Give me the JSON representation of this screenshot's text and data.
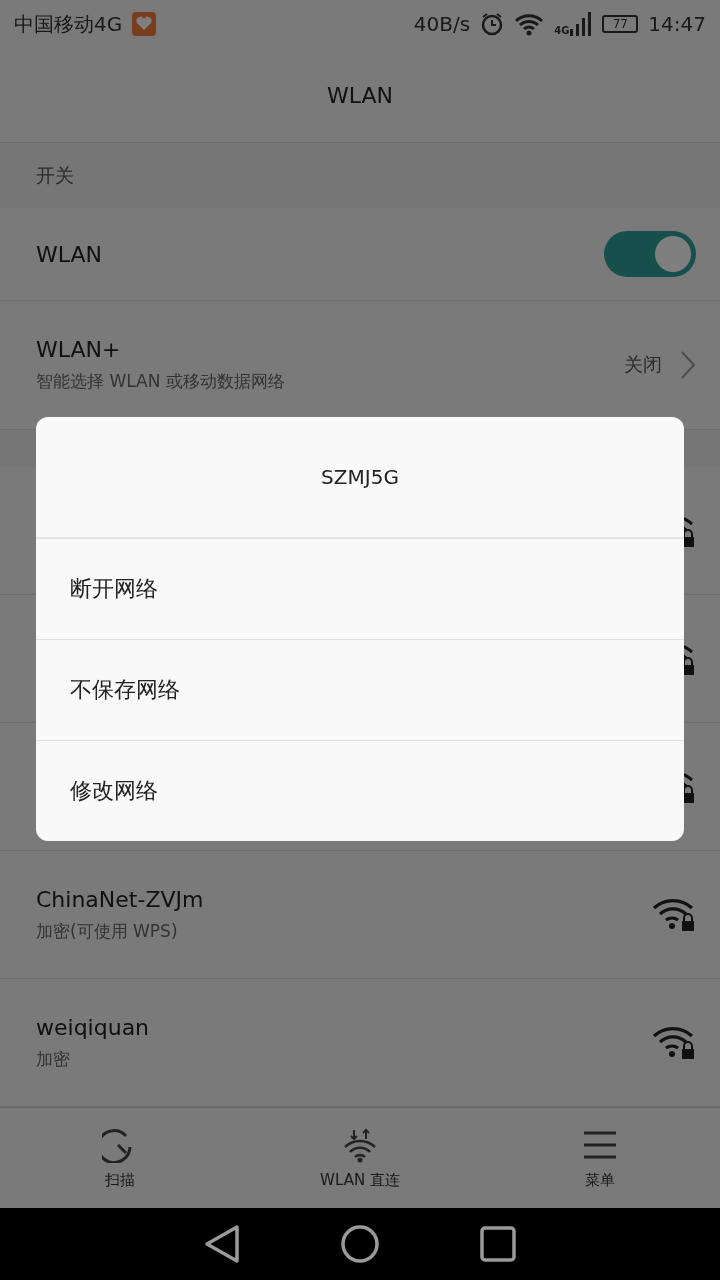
{
  "status_bar": {
    "carrier": "中国移动4G",
    "speed": "40B/s",
    "network_type": "4G",
    "battery": "77",
    "time": "14:47"
  },
  "title": "WLAN",
  "switch_section": {
    "header": "开关"
  },
  "wlan_row": {
    "label": "WLAN",
    "on": true
  },
  "wlan_plus_row": {
    "label": "WLAN+",
    "description": "智能选择 WLAN 或移动数据网络",
    "value": "关闭"
  },
  "networks": [
    {
      "secured": true
    },
    {
      "secured": true
    },
    {
      "secured": true
    },
    {
      "name": "ChinaNet-ZVJm",
      "status": "加密(可使用 WPS)",
      "secured": true
    },
    {
      "name": "weiqiquan",
      "status": "加密",
      "secured": true
    }
  ],
  "bottom_bar": [
    {
      "kind": "scan",
      "label": "扫描"
    },
    {
      "kind": "direct",
      "label": "WLAN 直连"
    },
    {
      "kind": "menu",
      "label": "菜单"
    }
  ],
  "dialog": {
    "title": "SZMJ5G",
    "options": [
      "断开网络",
      "不保存网络",
      "修改网络"
    ]
  }
}
